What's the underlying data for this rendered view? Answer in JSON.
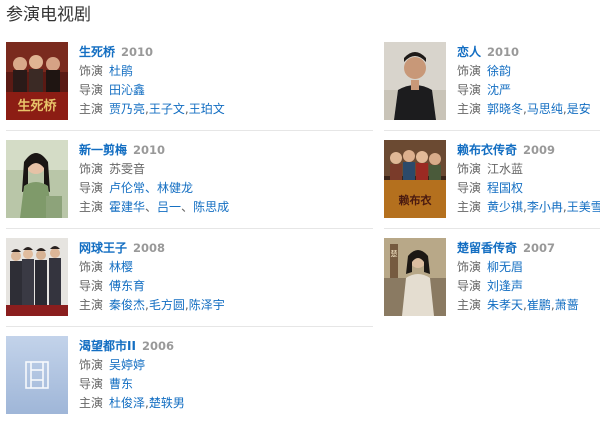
{
  "section": {
    "title": "参演电视剧"
  },
  "labels": {
    "role": "饰演",
    "director": "导演",
    "cast": "主演"
  },
  "dramas": [
    {
      "title": "生死桥",
      "year": "2010",
      "role": "杜鹃",
      "director": "田沁鑫",
      "cast": [
        "贾乃亮",
        "王子文",
        "王珀文"
      ]
    },
    {
      "title": "恋人",
      "year": "2010",
      "role": "徐韵",
      "director": "沈严",
      "cast": [
        "郭晓冬",
        "马思纯",
        "是安"
      ]
    },
    {
      "title": "新一剪梅",
      "year": "2010",
      "role": "苏雯音",
      "director": "卢伦常、林健龙",
      "cast": [
        "霍建华",
        "吕一",
        "陈思成"
      ]
    },
    {
      "title": "赖布衣传奇",
      "year": "2009",
      "role": "江水蓝",
      "director": "程国权",
      "cast": [
        "黄少祺",
        "李小冉",
        "王美雪"
      ]
    },
    {
      "title": "网球王子",
      "year": "2008",
      "role": "林樱",
      "director": "傅东育",
      "cast": [
        "秦俊杰",
        "毛方圆",
        "陈泽宇"
      ]
    },
    {
      "title": "楚留香传奇",
      "year": "2007",
      "role": "柳无眉",
      "director": "刘逢声",
      "cast": [
        "朱孝天",
        "崔鹏",
        "萧蔷"
      ]
    },
    {
      "title": "渴望都市II",
      "year": "2006",
      "role": "吴婷婷",
      "director": "曹东",
      "cast": [
        "杜俊泽",
        "楚轶男"
      ]
    }
  ]
}
